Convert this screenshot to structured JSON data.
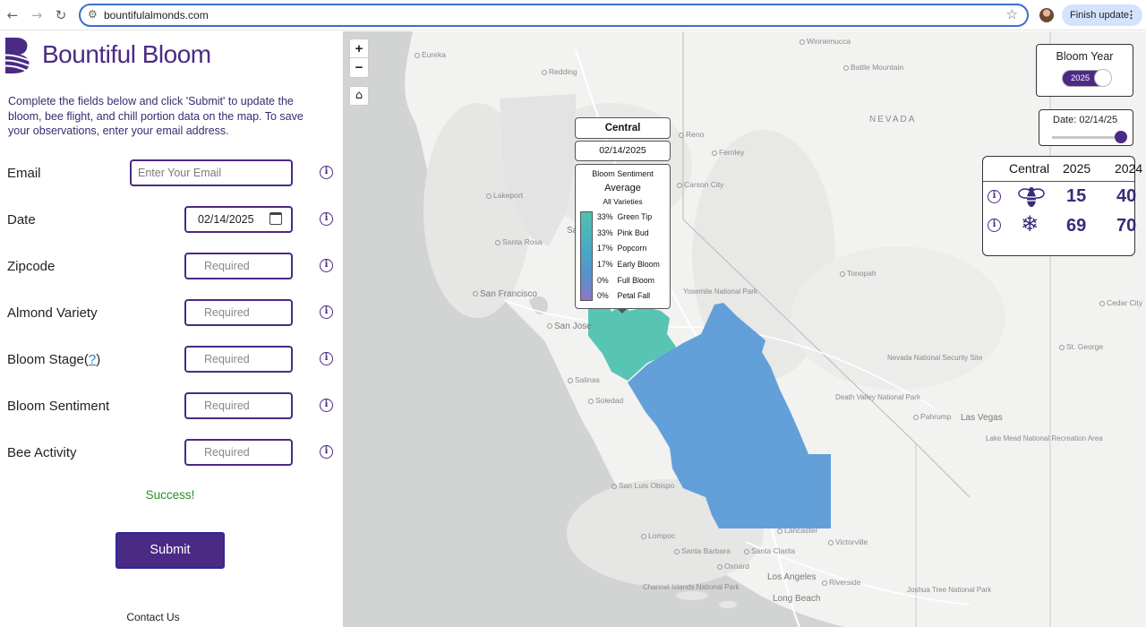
{
  "browser": {
    "url": "bountifulalmonds.com",
    "finish_update_label": "Finish update",
    "back_icon": "←",
    "forward_icon": "→",
    "reload_icon": "↻",
    "star_icon": "☆",
    "menu_icon": "⋮"
  },
  "brand": {
    "name": "Bountiful Bloom",
    "color": "#4a2a85"
  },
  "form": {
    "intro": "Complete the fields below and click 'Submit' to update the bloom, bee flight, and chill portion data on the map. To save your observations, enter your email address.",
    "fields": [
      {
        "label": "Email",
        "placeholder": "Enter Your Email"
      },
      {
        "label": "Date",
        "value": "02/14/2025"
      },
      {
        "label": "Zipcode",
        "placeholder": "Required"
      },
      {
        "label": "Almond Variety",
        "placeholder": "Required"
      },
      {
        "label": "Bloom Stage(",
        "help_link": "?",
        "label_suffix": ")",
        "placeholder": "Required"
      },
      {
        "label": "Bloom Sentiment",
        "placeholder": "Required"
      },
      {
        "label": "Bee Activity",
        "placeholder": "Required"
      }
    ],
    "info_glyph": "i",
    "success": "Success!",
    "submit_label": "Submit",
    "contact": "Contact Us"
  },
  "map": {
    "zoom_in": "+",
    "zoom_out": "−",
    "home_icon": "⌂",
    "region_colors": {
      "north": "#4fc2b0",
      "south": "#5b9bd8"
    },
    "labels": {
      "eureka": "Eureka",
      "redding": "Redding",
      "winnemucca": "Winnemucca",
      "battle_mountain": "Battle Mountain",
      "nevada": "NEVADA",
      "reno": "Reno",
      "fernley": "Fernley",
      "carson_city": "Carson City",
      "lakeport": "Lakeport",
      "santa_rosa": "Santa Rosa",
      "san_francisco": "San Francisco",
      "san_jose": "San Jose",
      "yosemite": "Yosemite National Park",
      "tonopah": "Tonopah",
      "cedar_city": "Cedar City",
      "st_george": "St. George",
      "nevada_security": "Nevada National Security Site",
      "death_valley": "Death Valley National Park",
      "pahrump": "Pahrump",
      "las_vegas": "Las Vegas",
      "lake_mead": "Lake Mead National Recreation Area",
      "salinas": "Salinas",
      "soledad": "Soledad",
      "san_luis_obispo": "San Luis Obispo",
      "lompoc": "Lompoc",
      "lancaster": "Lancaster",
      "victorville": "Victorville",
      "santa_barbara": "Santa Barbara",
      "santa_clarita": "Santa Clarita",
      "oxnard": "Oxnard",
      "los_angeles": "Los Angeles",
      "riverside": "Riverside",
      "long_beach": "Long Beach",
      "channel_islands": "Channel Islands National Park",
      "joshua_tree": "Joshua Tree National Park",
      "santa_partial": "Sa"
    }
  },
  "popup": {
    "title": "Central",
    "date": "02/14/2025",
    "heading": "Bloom Sentiment",
    "sentiment": "Average",
    "scope": "All Varieties",
    "stages": [
      {
        "pct": "33%",
        "name": "Green Tip"
      },
      {
        "pct": "33%",
        "name": "Pink Bud"
      },
      {
        "pct": "17%",
        "name": "Popcorn"
      },
      {
        "pct": "17%",
        "name": "Early Bloom"
      },
      {
        "pct": "0%",
        "name": "Full Bloom"
      },
      {
        "pct": "0%",
        "name": "Petal Fall"
      }
    ]
  },
  "controls": {
    "bloom_year_label": "Bloom Year",
    "bloom_year_value": "2025",
    "date_label": "Date: 02/14/25",
    "date_slider_fraction": 1.0
  },
  "stats": {
    "region": "Central",
    "year_a": "2025",
    "year_b": "2024",
    "bee_icon": "bee-icon",
    "snowflake_glyph": "❄",
    "bee": {
      "a": "15",
      "b": "40"
    },
    "chill": {
      "a": "69",
      "b": "70"
    }
  }
}
